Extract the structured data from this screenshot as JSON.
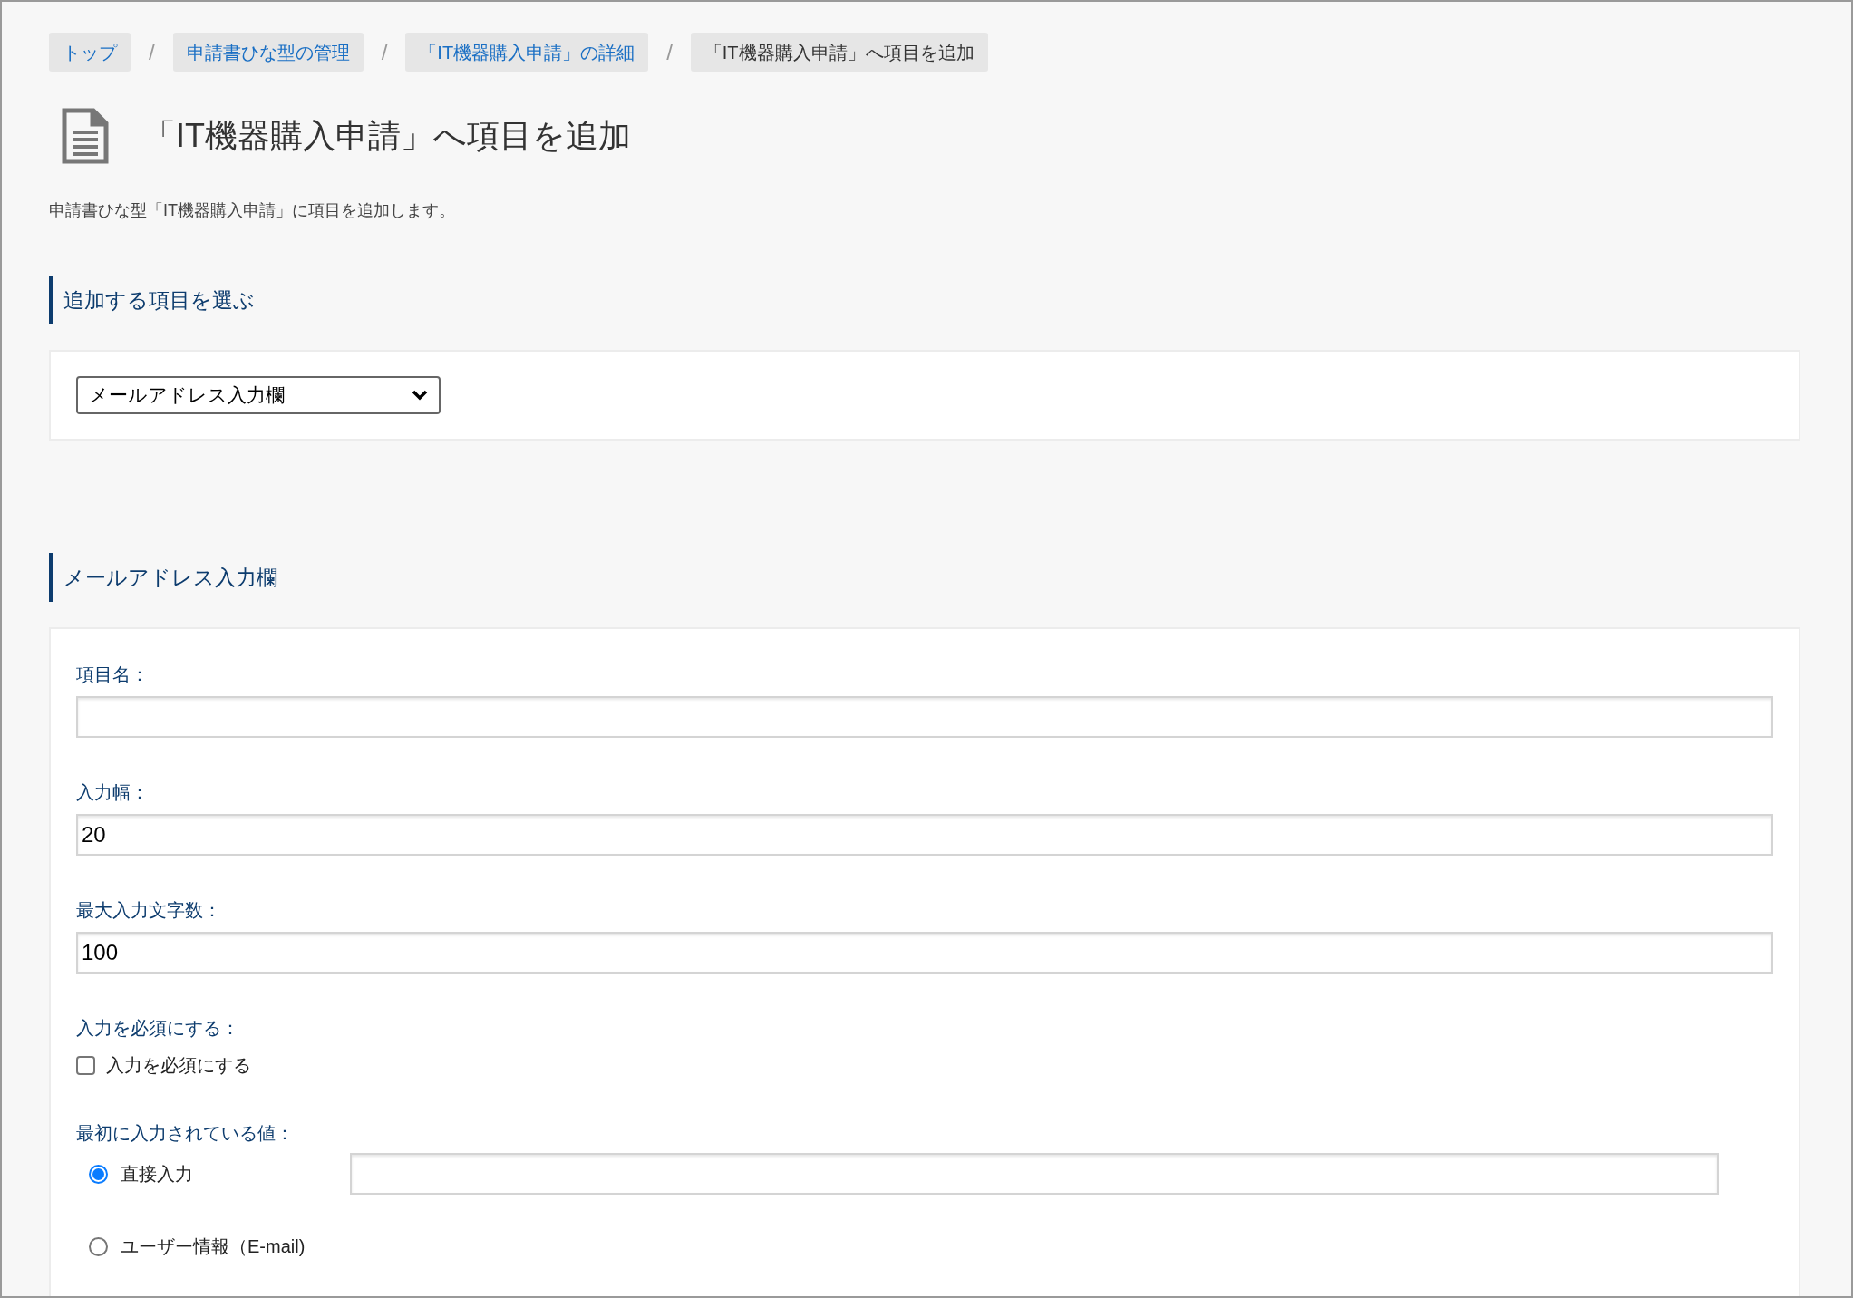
{
  "breadcrumb_separator": "/",
  "breadcrumb": [
    {
      "label": "トップ",
      "kind": "link"
    },
    {
      "label": "申請書ひな型の管理",
      "kind": "link"
    },
    {
      "label": "「IT機器購入申請」の詳細",
      "kind": "link"
    },
    {
      "label": "「IT機器購入申請」へ項目を追加",
      "kind": "current"
    }
  ],
  "page": {
    "title": "「IT機器購入申請」へ項目を追加",
    "description": "申請書ひな型「IT機器購入申請」に項目を追加します。"
  },
  "choose_section": {
    "heading": "追加する項目を選ぶ",
    "select": {
      "value": "メールアドレス入力欄"
    }
  },
  "item_section": {
    "heading": "メールアドレス入力欄",
    "fields": [
      {
        "kind": "text",
        "label": "項目名："
      },
      {
        "kind": "text",
        "label": "入力幅：",
        "value": "20"
      },
      {
        "kind": "text",
        "label": "最大入力文字数：",
        "value": "100"
      },
      {
        "kind": "checkbox",
        "label": "入力を必須にする：",
        "option": {
          "label": "入力を必須にする",
          "checked": false
        }
      },
      {
        "kind": "radio",
        "label": "最初に入力されている値：",
        "options": [
          {
            "label": "直接入力",
            "selected": true,
            "kind": "with-input"
          },
          {
            "label": "ユーザー情報（E-mail)",
            "selected": false,
            "kind": "plain"
          }
        ]
      }
    ]
  }
}
